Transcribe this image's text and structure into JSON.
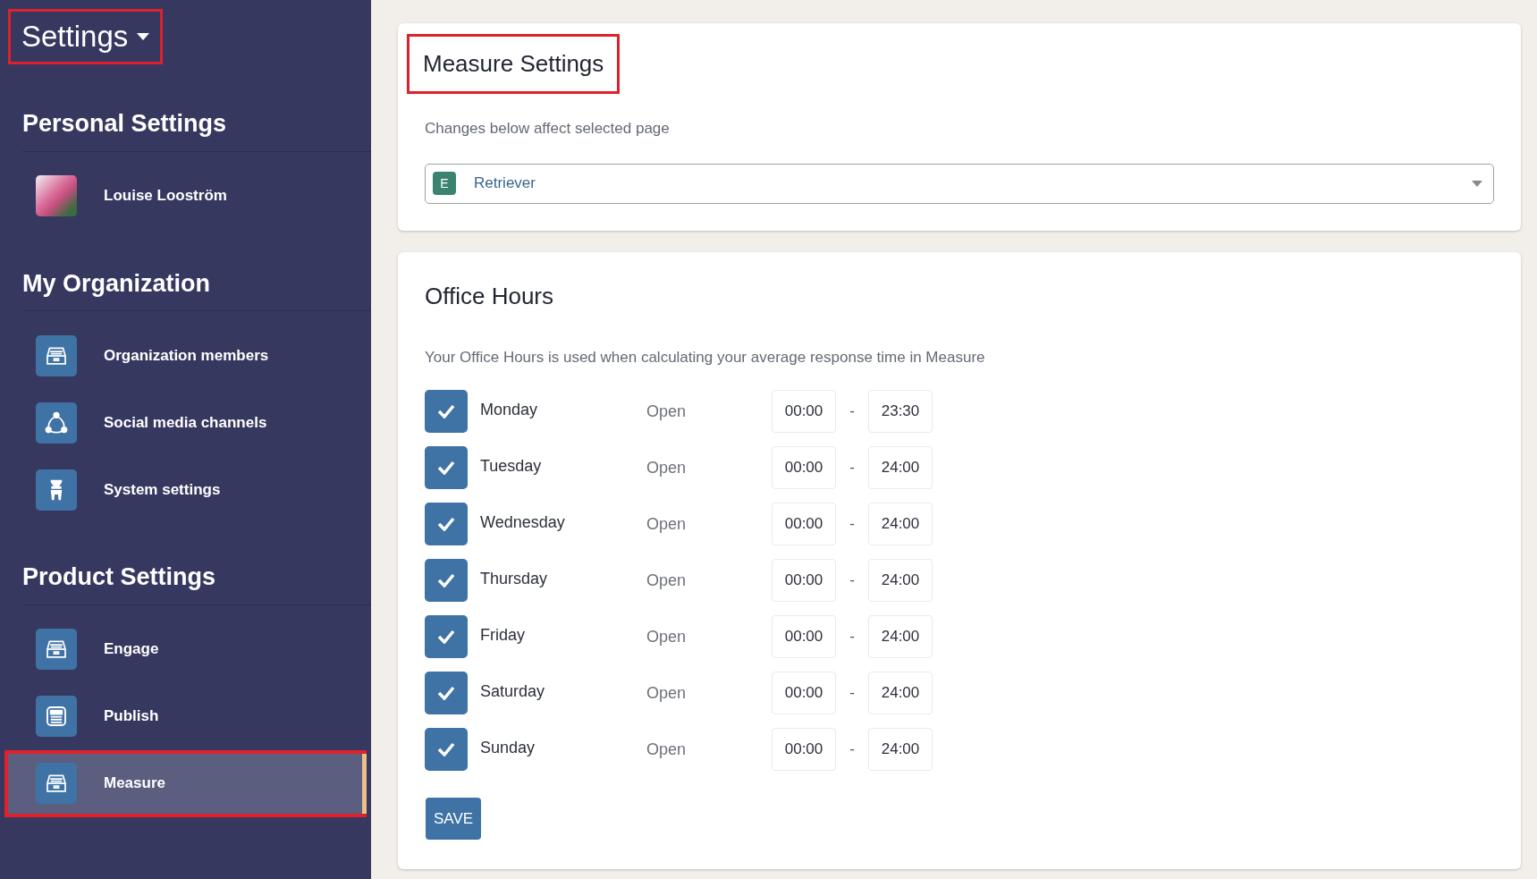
{
  "sidebar": {
    "title": {
      "label": "Settings",
      "highlighted": true
    },
    "sections": [
      {
        "heading": "Personal Settings",
        "items": [
          {
            "label": "Louise Looström",
            "kind": "avatar",
            "selected": false,
            "highlighted": false
          }
        ]
      },
      {
        "heading": "My Organization",
        "items": [
          {
            "label": "Organization members",
            "kind": "tray",
            "selected": false,
            "highlighted": false
          },
          {
            "label": "Social media channels",
            "kind": "network",
            "selected": false,
            "highlighted": false
          },
          {
            "label": "System settings",
            "kind": "chair",
            "selected": false,
            "highlighted": false
          }
        ]
      },
      {
        "heading": "Product Settings",
        "items": [
          {
            "label": "Engage",
            "kind": "tray",
            "selected": false,
            "highlighted": false
          },
          {
            "label": "Publish",
            "kind": "document",
            "selected": false,
            "highlighted": false
          },
          {
            "label": "Measure",
            "kind": "tray",
            "selected": true,
            "highlighted": true
          }
        ]
      }
    ]
  },
  "measure_settings": {
    "title": "Measure Settings",
    "title_highlighted": true,
    "description": "Changes below affect selected page",
    "page_select": {
      "badge": "E",
      "value": "Retriever"
    }
  },
  "office_hours": {
    "title": "Office Hours",
    "description": "Your Office Hours is used when calculating your average response time in Measure",
    "days": [
      {
        "day": "Monday",
        "checked": true,
        "status": "Open",
        "from": "00:00",
        "separator": "-",
        "to": "23:30"
      },
      {
        "day": "Tuesday",
        "checked": true,
        "status": "Open",
        "from": "00:00",
        "separator": "-",
        "to": "24:00"
      },
      {
        "day": "Wednesday",
        "checked": true,
        "status": "Open",
        "from": "00:00",
        "separator": "-",
        "to": "24:00"
      },
      {
        "day": "Thursday",
        "checked": true,
        "status": "Open",
        "from": "00:00",
        "separator": "-",
        "to": "24:00"
      },
      {
        "day": "Friday",
        "checked": true,
        "status": "Open",
        "from": "00:00",
        "separator": "-",
        "to": "24:00"
      },
      {
        "day": "Saturday",
        "checked": true,
        "status": "Open",
        "from": "00:00",
        "separator": "-",
        "to": "24:00"
      },
      {
        "day": "Sunday",
        "checked": true,
        "status": "Open",
        "from": "00:00",
        "separator": "-",
        "to": "24:00"
      }
    ],
    "save_button": "SAVE"
  }
}
